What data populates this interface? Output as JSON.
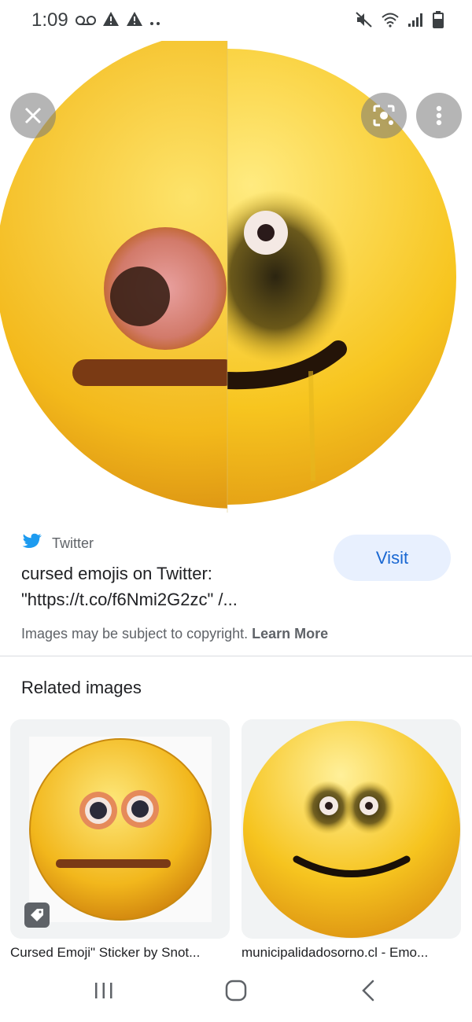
{
  "status_bar": {
    "time": "1:09",
    "left_icons": [
      "voicemail-icon",
      "alert-icon",
      "alert-icon",
      "more-dots-icon"
    ],
    "right_icons": [
      "mute-icon",
      "wifi-icon",
      "signal-icon",
      "battery-icon"
    ]
  },
  "viewer": {
    "buttons": [
      "close-icon",
      "lens-icon",
      "more-vert-icon"
    ]
  },
  "result": {
    "source_name": "Twitter",
    "title": "cursed emojis on Twitter: \"https://t.co/f6Nmi2G2zc\" /...",
    "visit_label": "Visit",
    "copyright_text": "Images may be subject to copyright.",
    "learn_more": "Learn More"
  },
  "related": {
    "heading": "Related images",
    "items": [
      {
        "caption": "Cursed Emoji\" Sticker by Snot..."
      },
      {
        "caption": "municipalidadosorno.cl - Emo..."
      }
    ]
  },
  "colors": {
    "accent": "#1967d2",
    "visit_bg": "#e8f0fe",
    "emoji_yellow": "#f6c21c",
    "twitter_blue": "#1d9bf0"
  }
}
